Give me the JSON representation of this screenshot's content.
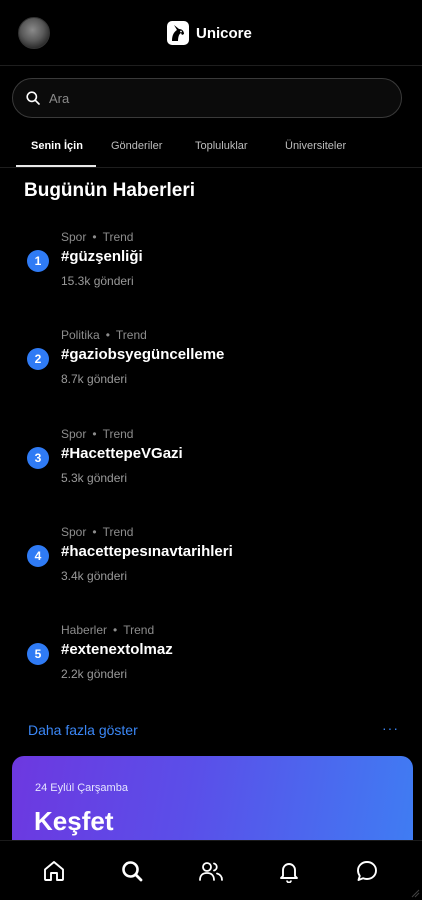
{
  "header": {
    "brand_name": "Unicore",
    "avatar_icon": "avatar",
    "logo_icon": "unicorn-logo-icon"
  },
  "search": {
    "placeholder": "Ara",
    "value": "",
    "icon": "search-icon"
  },
  "tabs": [
    {
      "label": "Senin İçin",
      "active": true
    },
    {
      "label": "Gönderiler",
      "active": false
    },
    {
      "label": "Topluluklar",
      "active": false
    },
    {
      "label": "Üniversiteler",
      "active": false
    }
  ],
  "section": {
    "title": "Bugünün Haberleri"
  },
  "trends": [
    {
      "rank": "1",
      "category": "Spor",
      "badge": "Trend",
      "tag": "#güzşenliği",
      "count": "15.3k gönderi"
    },
    {
      "rank": "2",
      "category": "Politika",
      "badge": "Trend",
      "tag": "#gaziobsyegüncelleme",
      "count": "8.7k gönderi"
    },
    {
      "rank": "3",
      "category": "Spor",
      "badge": "Trend",
      "tag": "#HacettepeVGazi",
      "count": "5.3k gönderi"
    },
    {
      "rank": "4",
      "category": "Spor",
      "badge": "Trend",
      "tag": "#hacettepesınavtarihleri",
      "count": "3.4k gönderi"
    },
    {
      "rank": "5",
      "category": "Haberler",
      "badge": "Trend",
      "tag": "#extenextolmaz",
      "count": "2.2k gönderi"
    }
  ],
  "more": {
    "label": "Daha fazla göster",
    "dots": "···"
  },
  "discover": {
    "date": "24 Eylül Çarşamba",
    "title": "Keşfet"
  },
  "bottom_nav": [
    {
      "icon": "home-icon"
    },
    {
      "icon": "search-icon",
      "active": true
    },
    {
      "icon": "users-icon"
    },
    {
      "icon": "bell-icon"
    },
    {
      "icon": "chat-icon"
    }
  ],
  "colors": {
    "background": "#000000",
    "accent": "#3b87f6",
    "rank_badge": "#2f7bf5",
    "discover_gradient_start": "#6d38e0",
    "discover_gradient_end": "#3f7df3"
  }
}
